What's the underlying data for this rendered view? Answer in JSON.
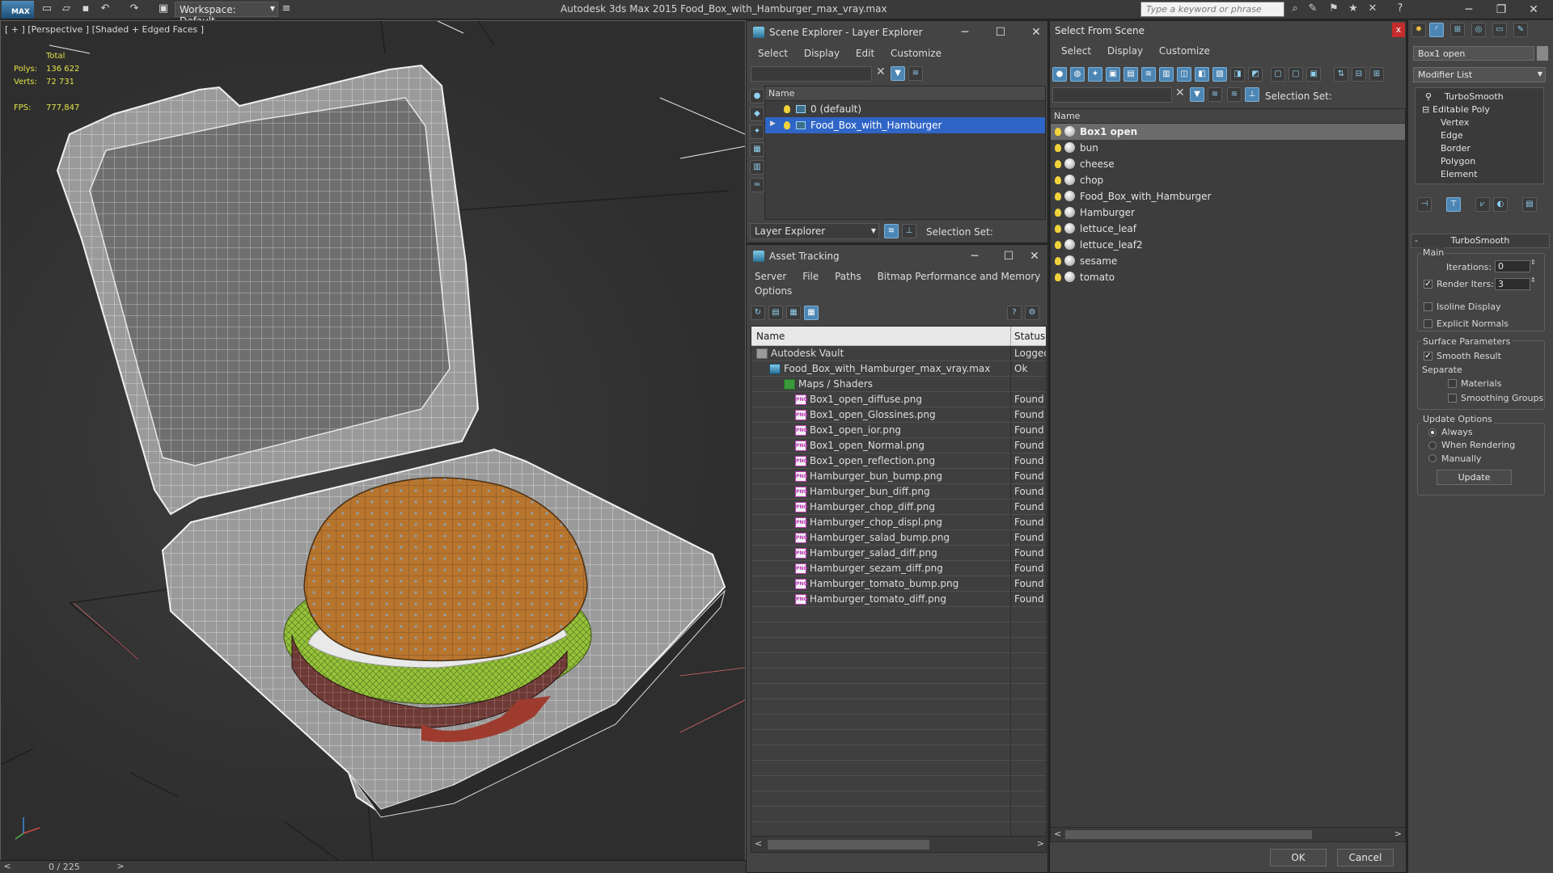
{
  "titlebar": {
    "logo": "MAX",
    "workspace": "Workspace: Default",
    "window_title": "Autodesk 3ds Max  2015     Food_Box_with_Hamburger_max_vray.max",
    "search_placeholder": "Type a keyword or phrase"
  },
  "viewport": {
    "label": "[ + ] [Perspective ] [Shaded + Edged Faces ]",
    "stats": {
      "total_label": "Total",
      "polys_label": "Polys:",
      "polys_value": "136 622",
      "verts_label": "Verts:",
      "verts_value": "72 731",
      "fps_label": "FPS:",
      "fps_value": "777,847"
    }
  },
  "timeslider": {
    "frame": "0 / 225"
  },
  "layer_explorer": {
    "title": "Scene Explorer - Layer Explorer",
    "menu": [
      "Select",
      "Display",
      "Edit",
      "Customize"
    ],
    "column_name": "Name",
    "layers": [
      {
        "label": "0 (default)",
        "selected": false
      },
      {
        "label": "Food_Box_with_Hamburger",
        "selected": true
      }
    ],
    "footer_dropdown": "Layer Explorer",
    "selection_set_label": "Selection Set:"
  },
  "asset_tracking": {
    "title": "Asset Tracking",
    "menu_row1": [
      "Server",
      "File",
      "Paths",
      "Bitmap Performance and Memory"
    ],
    "menu_row2": [
      "Options"
    ],
    "columns": [
      "Name",
      "Status"
    ],
    "rows": [
      {
        "name": "Autodesk Vault",
        "status": "Logged",
        "indent": 1,
        "icon": "vault"
      },
      {
        "name": "Food_Box_with_Hamburger_max_vray.max",
        "status": "Ok",
        "indent": 2,
        "icon": "max"
      },
      {
        "name": "Maps / Shaders",
        "status": "",
        "indent": 3,
        "icon": "maps"
      },
      {
        "name": "Box1_open_diffuse.png",
        "status": "Found",
        "indent": 4,
        "icon": "png"
      },
      {
        "name": "Box1_open_Glossines.png",
        "status": "Found",
        "indent": 4,
        "icon": "png"
      },
      {
        "name": "Box1_open_ior.png",
        "status": "Found",
        "indent": 4,
        "icon": "png"
      },
      {
        "name": "Box1_open_Normal.png",
        "status": "Found",
        "indent": 4,
        "icon": "png"
      },
      {
        "name": "Box1_open_reflection.png",
        "status": "Found",
        "indent": 4,
        "icon": "png"
      },
      {
        "name": "Hamburger_bun_bump.png",
        "status": "Found",
        "indent": 4,
        "icon": "png"
      },
      {
        "name": "Hamburger_bun_diff.png",
        "status": "Found",
        "indent": 4,
        "icon": "png"
      },
      {
        "name": "Hamburger_chop_diff.png",
        "status": "Found",
        "indent": 4,
        "icon": "png"
      },
      {
        "name": "Hamburger_chop_displ.png",
        "status": "Found",
        "indent": 4,
        "icon": "png"
      },
      {
        "name": "Hamburger_salad_bump.png",
        "status": "Found",
        "indent": 4,
        "icon": "png"
      },
      {
        "name": "Hamburger_salad_diff.png",
        "status": "Found",
        "indent": 4,
        "icon": "png"
      },
      {
        "name": "Hamburger_sezam_diff.png",
        "status": "Found",
        "indent": 4,
        "icon": "png"
      },
      {
        "name": "Hamburger_tomato_bump.png",
        "status": "Found",
        "indent": 4,
        "icon": "png"
      },
      {
        "name": "Hamburger_tomato_diff.png",
        "status": "Found",
        "indent": 4,
        "icon": "png"
      }
    ],
    "png_badge": "PNG"
  },
  "select_from_scene": {
    "title": "Select From Scene",
    "close": "x",
    "menu": [
      "Select",
      "Display",
      "Customize"
    ],
    "selection_set_label": "Selection Set:",
    "column_name": "Name",
    "objects": [
      "Box1 open",
      "bun",
      "cheese",
      "chop",
      "Food_Box_with_Hamburger",
      "Hamburger",
      "lettuce_leaf",
      "lettuce_leaf2",
      "sesame",
      "tomato"
    ],
    "ok": "OK",
    "cancel": "Cancel"
  },
  "command_panel": {
    "object_name": "Box1 open",
    "modifier_list": "Modifier List",
    "stack": [
      "TurboSmooth",
      "Editable Poly",
      "Vertex",
      "Edge",
      "Border",
      "Polygon",
      "Element"
    ],
    "rollout_title": "TurboSmooth",
    "main_label": "Main",
    "iterations_label": "Iterations:",
    "iterations_value": "0",
    "render_iters_label": "Render Iters:",
    "render_iters_value": "3",
    "render_iters_checked": true,
    "isoline_label": "Isoline Display",
    "explicit_normals_label": "Explicit Normals",
    "surface_params_label": "Surface Parameters",
    "smooth_result_label": "Smooth Result",
    "separate_label": "Separate",
    "materials_label": "Materials",
    "smoothing_groups_label": "Smoothing Groups",
    "update_options_label": "Update Options",
    "always_label": "Always",
    "when_rendering_label": "When Rendering",
    "manually_label": "Manually",
    "update_button": "Update",
    "check_mark": "✓",
    "collapse": "-"
  },
  "colors": {
    "selection_blue": "#2f65c6",
    "stats_yellow": "#e3e24a",
    "close_red": "#c42b2b"
  }
}
